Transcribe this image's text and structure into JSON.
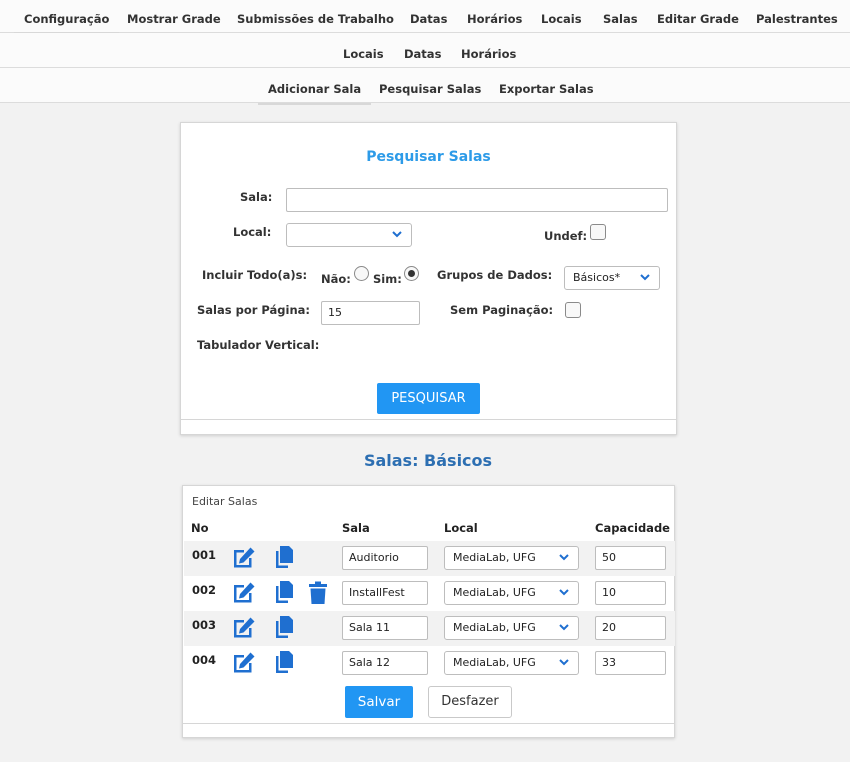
{
  "nav_main": {
    "items": [
      "Configuração",
      "Mostrar Grade",
      "Submissões de Trabalho",
      "Datas",
      "Horários",
      "Locais",
      "Salas",
      "Editar Grade",
      "Palestrantes"
    ]
  },
  "nav_sub": {
    "items": [
      "Locais",
      "Datas",
      "Horários"
    ]
  },
  "nav_salas": {
    "items": [
      "Adicionar Sala",
      "Pesquisar Salas",
      "Exportar Salas"
    ]
  },
  "search": {
    "title": "Pesquisar Salas",
    "sala_label": "Sala:",
    "sala_value": "",
    "local_label": "Local:",
    "local_value": "",
    "undef_label": "Undef:",
    "incluir_label": "Incluir Todo(a)s:",
    "nao_label": "Não:",
    "sim_label": "Sim:",
    "incluir_selected": "Sim",
    "grupos_label": "Grupos de Dados:",
    "grupos_value": "Básicos*",
    "por_pagina_label": "Salas por Página:",
    "por_pagina_value": "15",
    "sem_paginacao_label": "Sem Paginação:",
    "tabulador_label": "Tabulador Vertical:",
    "submit_label": "PESQUISAR"
  },
  "results": {
    "title": "Salas: Básicos",
    "caption": "Editar Salas",
    "columns": [
      "No",
      "Sala",
      "Local",
      "Capacidade"
    ],
    "rows": [
      {
        "no": "001",
        "sala": "Auditorio",
        "local": "MediaLab, UFG",
        "capacidade": "50",
        "deletable": false
      },
      {
        "no": "002",
        "sala": "InstallFest",
        "local": "MediaLab, UFG",
        "capacidade": "10",
        "deletable": true
      },
      {
        "no": "003",
        "sala": "Sala 11",
        "local": "MediaLab, UFG",
        "capacidade": "20",
        "deletable": false
      },
      {
        "no": "004",
        "sala": "Sala 12",
        "local": "MediaLab, UFG",
        "capacidade": "33",
        "deletable": false
      }
    ],
    "save_label": "Salvar",
    "undo_label": "Desfazer"
  },
  "colors": {
    "accent": "#2196f3",
    "title_blue": "#2d9be8",
    "icon_blue": "#1f6fd0"
  },
  "icons": {
    "edit": "edit-icon",
    "copy": "copy-icon",
    "delete": "trash-icon",
    "dropdown": "chevron-down-icon"
  }
}
